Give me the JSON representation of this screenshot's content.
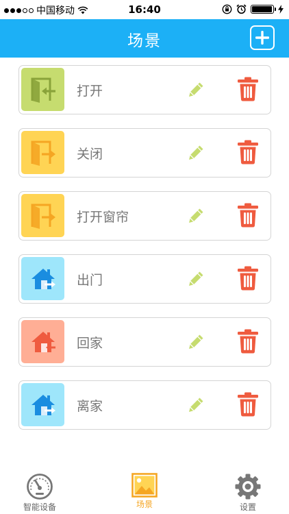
{
  "status_bar": {
    "carrier": "中国移动",
    "time": "16:40"
  },
  "header": {
    "title": "场景",
    "add_icon": "plus-icon"
  },
  "scenes": [
    {
      "name": "打开",
      "icon": "enter-door-icon",
      "icon_bg": "#c6dc6f",
      "icon_fg": "#8aa33a"
    },
    {
      "name": "关闭",
      "icon": "exit-door-icon",
      "icon_bg": "#ffd454",
      "icon_fg": "#f5a623"
    },
    {
      "name": "打开窗帘",
      "icon": "exit-door-icon",
      "icon_bg": "#ffd454",
      "icon_fg": "#f5a623"
    },
    {
      "name": "出门",
      "icon": "house-exit-icon",
      "icon_bg": "#9ee6fb",
      "icon_fg": "#1a8de0"
    },
    {
      "name": "回家",
      "icon": "house-enter-icon",
      "icon_bg": "#ffae95",
      "icon_fg": "#ef5b3f"
    },
    {
      "name": "离家",
      "icon": "house-exit-icon",
      "icon_bg": "#9ee6fb",
      "icon_fg": "#1a8de0"
    }
  ],
  "colors": {
    "header": "#1cb0f6",
    "edit": "#c6dc6f",
    "delete": "#ef5b3f",
    "tab_active": "#f5a623"
  },
  "tabs": [
    {
      "label": "智能设备",
      "icon": "gauge-icon",
      "active": false
    },
    {
      "label": "场景",
      "icon": "picture-icon",
      "active": true
    },
    {
      "label": "设置",
      "icon": "gear-icon",
      "active": false
    }
  ]
}
